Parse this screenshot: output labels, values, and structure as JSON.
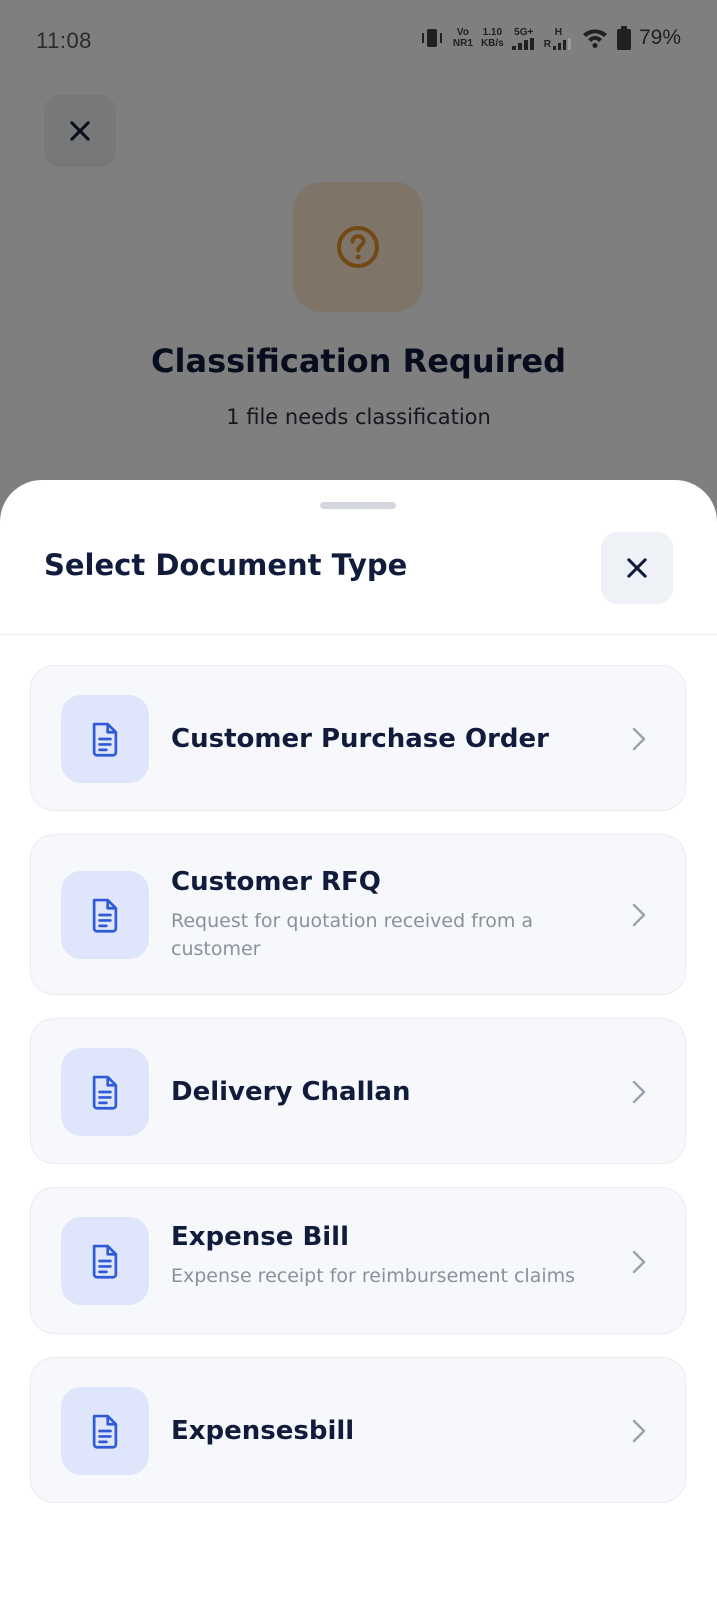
{
  "status_bar": {
    "time": "11:08",
    "network_vo": "Vo",
    "network_nr": "NR1",
    "speed_value": "1.10",
    "speed_unit": "KB/s",
    "net_5g": "5G+",
    "net_h": "H",
    "net_r": "R",
    "battery": "79%"
  },
  "background": {
    "title": "Classification Required",
    "subtitle": "1 file needs classification",
    "hero_icon": "question-circle-icon",
    "accent_color": "#e5902a"
  },
  "sheet": {
    "title": "Select Document Type",
    "items": [
      {
        "title": "Customer Purchase Order",
        "description": ""
      },
      {
        "title": "Customer RFQ",
        "description": "Request for quotation received from a customer"
      },
      {
        "title": "Delivery Challan",
        "description": ""
      },
      {
        "title": "Expense Bill",
        "description": "Expense receipt for reimbursement claims"
      },
      {
        "title": "Expensesbill",
        "description": ""
      }
    ],
    "item_icon": "document-icon",
    "icon_color": "#2f5bd6"
  }
}
